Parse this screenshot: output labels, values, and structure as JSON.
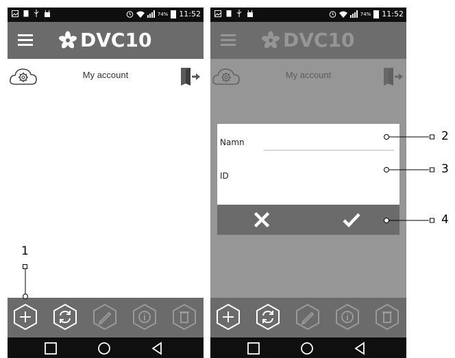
{
  "status_bar": {
    "time": "11:52",
    "battery_pct": "74%"
  },
  "app": {
    "name": "DVC10"
  },
  "account": {
    "title": "My account"
  },
  "dialog": {
    "name_label": "Namn",
    "name_value": "",
    "id_label": "ID",
    "id_value": ""
  },
  "callouts": [
    "1",
    "2",
    "3",
    "4"
  ],
  "toolbar": {
    "icons": [
      "add-icon",
      "sync-icon",
      "edit-icon",
      "info-icon",
      "delete-icon"
    ]
  },
  "colors": {
    "appbar": "#6b6b6b",
    "statusbar": "#0f0f0f",
    "overlay": "#6e6e6e",
    "icon_active": "#ffffff",
    "icon_disabled": "#9a9a9a"
  }
}
